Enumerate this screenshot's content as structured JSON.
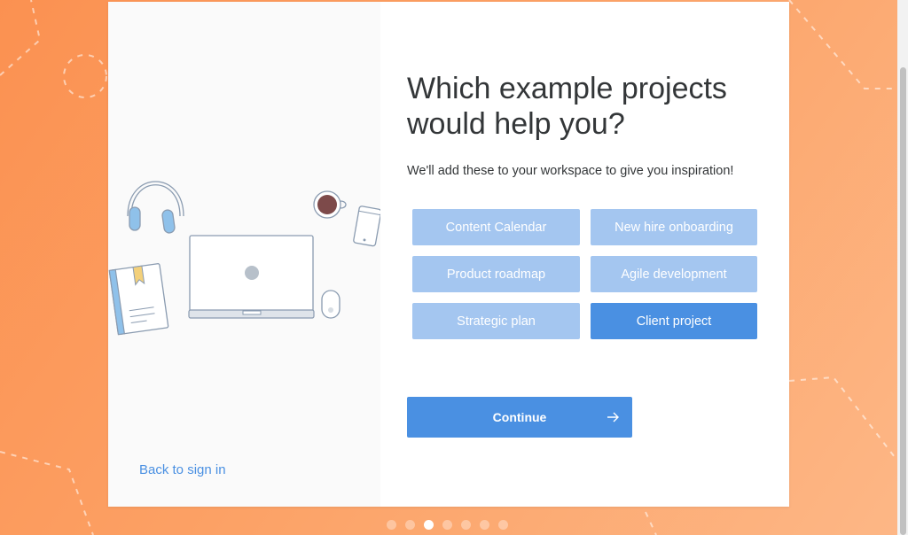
{
  "onboarding": {
    "heading": "Which example projects would help you?",
    "subtext": "We'll add these to your workspace to give you inspiration!",
    "options": [
      {
        "label": "Content Calendar",
        "selected": false
      },
      {
        "label": "New hire onboarding",
        "selected": false
      },
      {
        "label": "Product roadmap",
        "selected": false
      },
      {
        "label": "Agile development",
        "selected": false
      },
      {
        "label": "Strategic plan",
        "selected": false
      },
      {
        "label": "Client project",
        "selected": true
      }
    ],
    "continue_label": "Continue",
    "continue_icon": "arrow-right-icon",
    "back_link": "Back to sign in",
    "progress": {
      "total_steps": 7,
      "current_step": 3
    }
  },
  "colors": {
    "accent": "#4a90e2",
    "option_unselected": "#a4c6f0",
    "background_start": "#fb9151",
    "background_end": "#fdb786"
  }
}
